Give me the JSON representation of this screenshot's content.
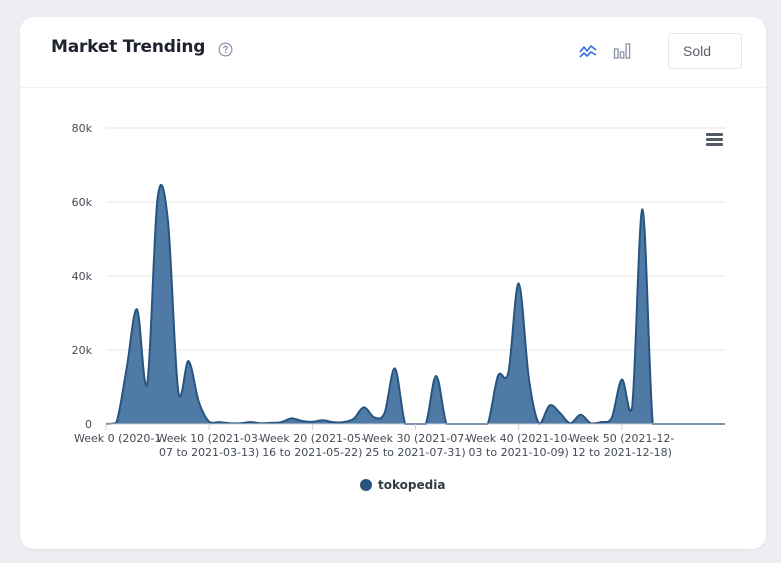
{
  "header": {
    "title": "Market Trending",
    "metric_selected": "Sold",
    "help_icon": "question-circle-icon",
    "line_toggle_icon": "line-chart-icon",
    "bar_toggle_icon": "bar-chart-icon",
    "menu_icon": "hamburger-menu-icon"
  },
  "colors": {
    "series": "#285580",
    "series_fill": "#4f7aa5",
    "accent": "#2f6fdc"
  },
  "chart_data": {
    "type": "area",
    "title": "",
    "xlabel": "",
    "ylabel": "",
    "ylim": [
      0,
      80000
    ],
    "yticks": [
      0,
      20000,
      40000,
      60000,
      80000
    ],
    "ytick_labels": [
      "0",
      "20k",
      "40k",
      "60k",
      "80k"
    ],
    "x": [
      0,
      1,
      2,
      3,
      4,
      5,
      6,
      7,
      8,
      9,
      10,
      11,
      12,
      13,
      14,
      15,
      16,
      17,
      18,
      19,
      20,
      21,
      22,
      23,
      24,
      25,
      26,
      27,
      28,
      29,
      30,
      31,
      32,
      33,
      34,
      35,
      36,
      37,
      38,
      39,
      40,
      41,
      42,
      43,
      44,
      45,
      46,
      47,
      48,
      49,
      50,
      51,
      52,
      53,
      54,
      55,
      56,
      57,
      58,
      59,
      60
    ],
    "xticks": [
      0,
      10,
      20,
      30,
      40,
      50
    ],
    "xtick_labels": [
      [
        "Week 0 (2020-1"
      ],
      [
        "Week 10 (2021-03-",
        "07 to 2021-03-13)"
      ],
      [
        "Week 20 (2021-05-",
        "16 to 2021-05-22)"
      ],
      [
        "Week 30 (2021-07-",
        "25 to 2021-07-31)"
      ],
      [
        "Week 40 (2021-10-",
        "03 to 2021-10-09)"
      ],
      [
        "Week 50 (2021-12-",
        "12 to 2021-12-18)"
      ]
    ],
    "grid": true,
    "legend_position": "bottom-center",
    "series": [
      {
        "name": "tokopedia",
        "values": [
          0,
          300,
          15000,
          31000,
          11000,
          61000,
          55000,
          9000,
          17000,
          6000,
          600,
          500,
          200,
          200,
          500,
          200,
          300,
          500,
          1500,
          800,
          600,
          1000,
          500,
          500,
          1400,
          4500,
          1800,
          3000,
          15000,
          0,
          0,
          0,
          13000,
          0,
          0,
          0,
          0,
          0,
          13000,
          14000,
          38000,
          12000,
          0,
          5000,
          3000,
          200,
          2500,
          200,
          500,
          1500,
          12000,
          4500,
          58000,
          0,
          0,
          0,
          0,
          0,
          0,
          0,
          0
        ]
      }
    ]
  }
}
